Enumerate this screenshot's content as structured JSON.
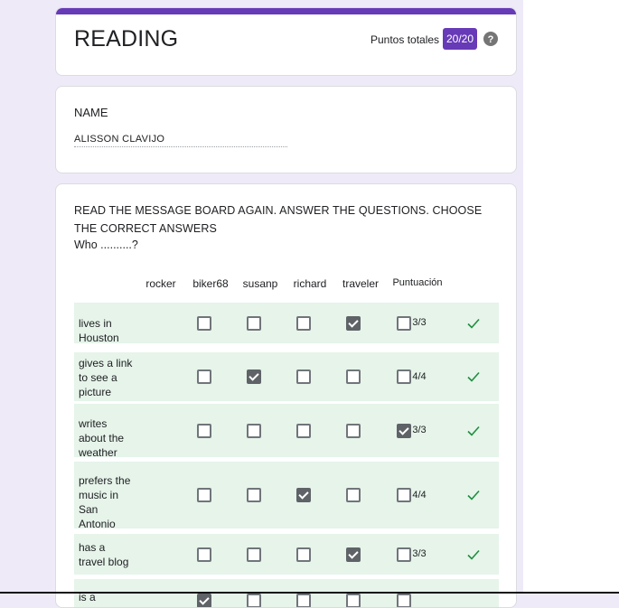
{
  "form": {
    "title": "READING",
    "points_label": "Puntos totales",
    "points_value": "20/20"
  },
  "name_section": {
    "label": "NAME",
    "value": "ALISSON CLAVIJO"
  },
  "question": {
    "text": "READ THE MESSAGE BOARD AGAIN. ANSWER THE QUESTIONS. CHOOSE THE CORRECT ANSWERS",
    "subtext": "Who ..........?",
    "columns": [
      "rocker",
      "biker68",
      "susanp",
      "richard",
      "traveler"
    ],
    "score_header": "Puntuación",
    "rows": [
      {
        "label": "lives in Houston",
        "checked_index": 3,
        "score": "3/3"
      },
      {
        "label": "gives a link to see a picture",
        "checked_index": 1,
        "score": "4/4"
      },
      {
        "label": "writes about the weather",
        "checked_index": 4,
        "score": "3/3"
      },
      {
        "label": "prefers the music in San Antonio",
        "checked_index": 2,
        "score": "4/4"
      },
      {
        "label": "has a travel blog",
        "checked_index": 3,
        "score": "3/3"
      },
      {
        "label": "is a",
        "checked_index": 0,
        "score": ""
      }
    ]
  },
  "icons": {
    "help": "help-circle-icon",
    "correct": "check-icon"
  },
  "colors": {
    "accent": "#673ab7",
    "correct_row_bg": "#e6f4ea",
    "check_green": "#1e8e3e"
  }
}
